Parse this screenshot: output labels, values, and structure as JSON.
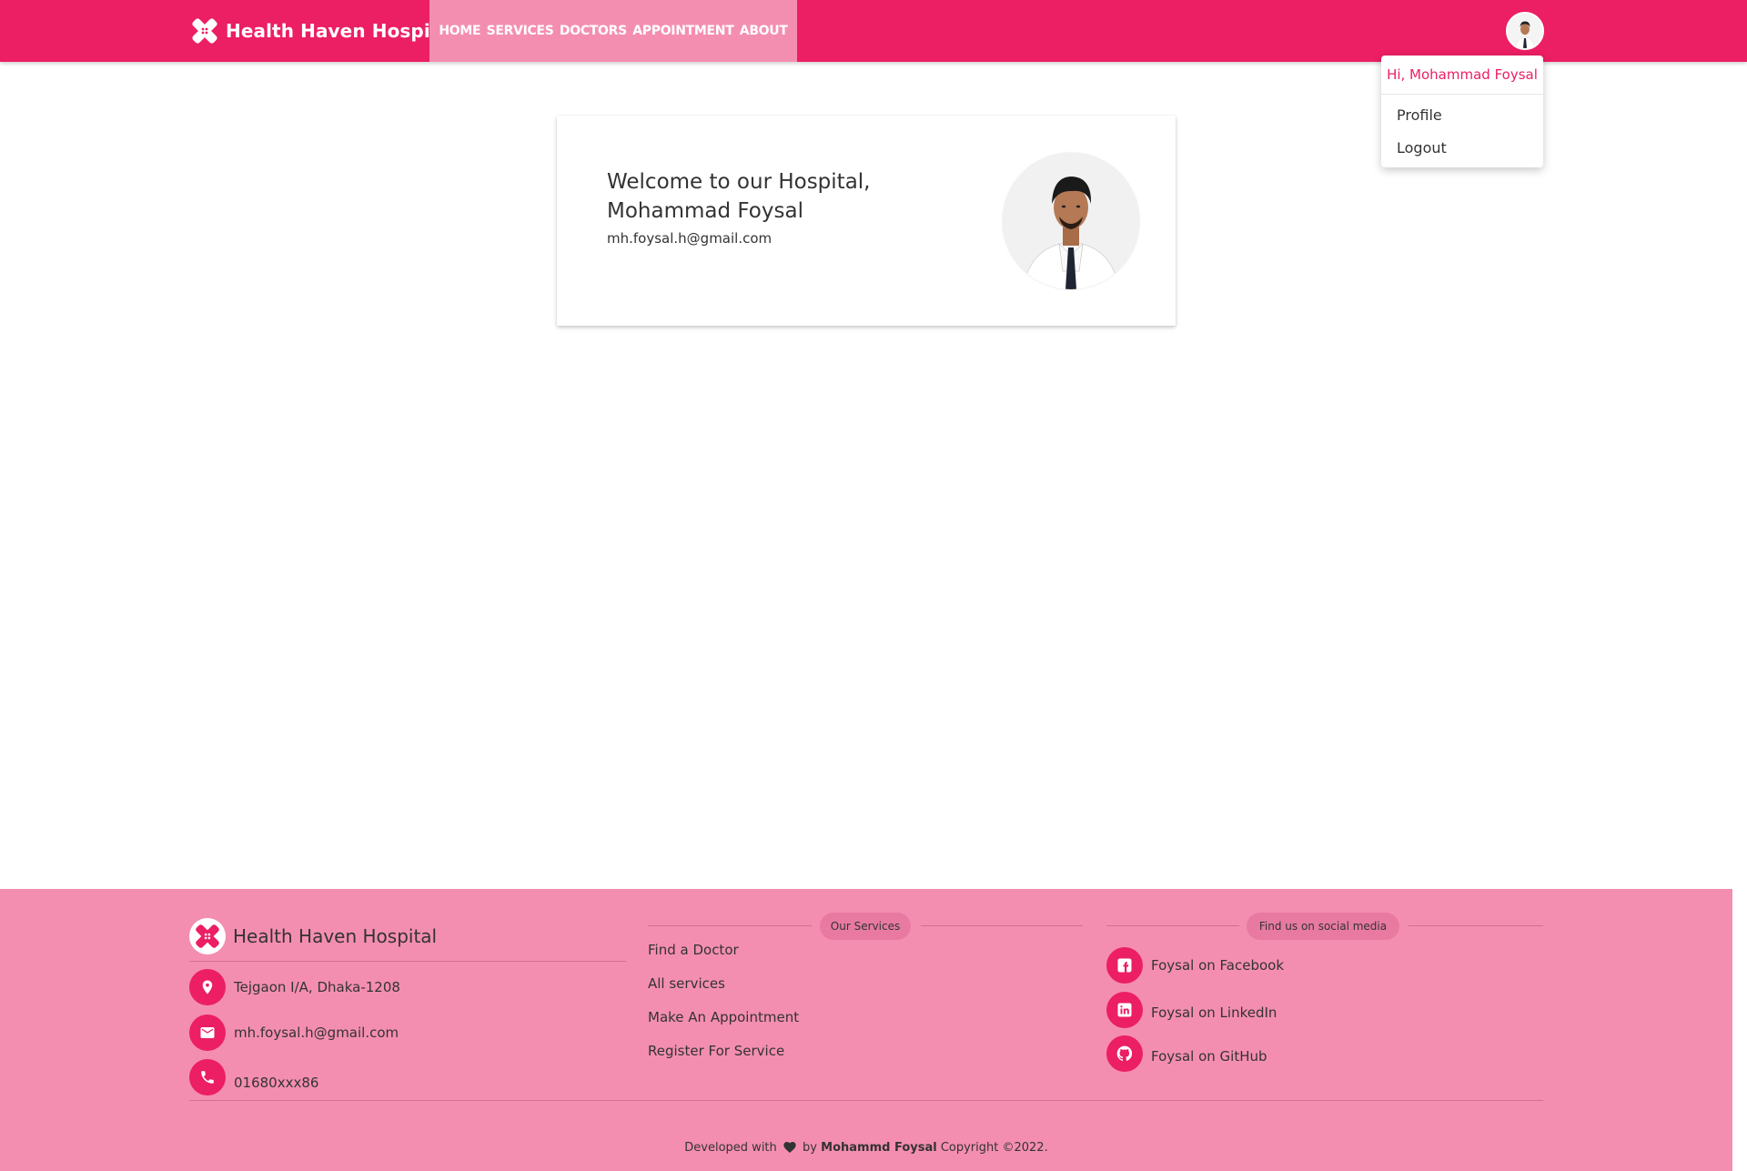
{
  "navbar": {
    "brand": "Health Haven Hospital",
    "links": [
      "HOME",
      "SERVICES",
      "DOCTORS",
      "APPOINTMENT",
      "ABOUT"
    ],
    "avatar_icon": "user-avatar-icon"
  },
  "dropdown": {
    "greeting": "Hi, Mohammad Foysal",
    "items": [
      "Profile",
      "Logout"
    ]
  },
  "welcome": {
    "line1": "Welcome to our Hospital,",
    "line2": "Mohammad Foysal",
    "email": "mh.foysal.h@gmail.com"
  },
  "footer": {
    "brand": "Health Haven Hospital",
    "contact": {
      "address": "Tejgaon I/A, Dhaka-1208",
      "email": "mh.foysal.h@gmail.com",
      "phone": "01680xxx86"
    },
    "services": {
      "heading": "Our Services",
      "links": [
        "Find a Doctor",
        "All services",
        "Make An Appointment",
        "Register For Service"
      ]
    },
    "social": {
      "heading": "Find us on social media",
      "links": [
        "Foysal on Facebook",
        "Foysal on LinkedIn",
        "Foysal on GitHub"
      ]
    },
    "copyright": {
      "prefix": "Developed with",
      "by": "by",
      "author": "Mohammd Foysal",
      "suffix": "Copyright ©2022."
    }
  },
  "colors": {
    "primary": "#ec1e64",
    "footer_bg": "#f48eb0",
    "nav_links_bg": "#f48eb0"
  }
}
